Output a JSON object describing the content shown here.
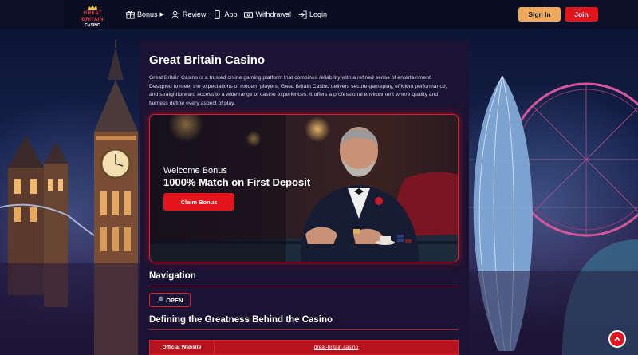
{
  "header": {
    "logo_line1": "GREAT BRITAIN",
    "logo_line2": "CASINO",
    "nav": [
      {
        "label": "Bonus",
        "icon": "gift-icon"
      },
      {
        "label": "Review",
        "icon": "user-review-icon"
      },
      {
        "label": "App",
        "icon": "phone-icon"
      },
      {
        "label": "Withdrawal",
        "icon": "money-icon"
      },
      {
        "label": "Login",
        "icon": "login-icon"
      }
    ],
    "signin_label": "Sign In",
    "join_label": "Join"
  },
  "main": {
    "title": "Great Britain Casino",
    "intro": "Great Britain Casino is a trusted online gaming platform that combines reliability with a refined sense of entertainment. Designed to meet the expectations of modern players, Great Britain Casino delivers secure gameplay, efficient performance, and straightforward access to a wide range of casino experiences. It offers a professional environment where quality and fairness define every aspect of play.",
    "banner": {
      "subtitle": "Welcome Bonus",
      "headline": "1000% Match on First Deposit",
      "button": "Claim Bonus"
    },
    "navigation_title": "Navigation",
    "open_label": "OPEN",
    "section2_title": "Defining the Greatness Behind the Casino",
    "table": {
      "key": "Official Website",
      "value": "great-britain.casino"
    }
  },
  "colors": {
    "accent_red": "#e3141c",
    "signin_orange": "#f0a85b",
    "panel_bg": "#1b1333"
  }
}
